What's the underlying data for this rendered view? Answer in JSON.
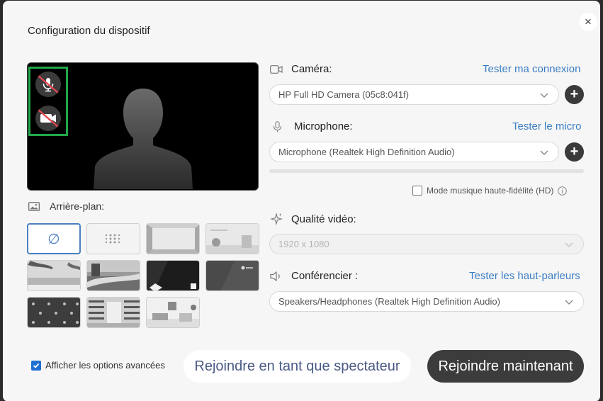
{
  "dialog": {
    "title": "Configuration du dispositif",
    "close": "×"
  },
  "camera": {
    "label": "Caméra:",
    "link": "Tester ma connexion",
    "selected": "HP Full HD Camera (05c8:041f)"
  },
  "microphone": {
    "label": "Microphone:",
    "link": "Tester le micro",
    "selected": "Microphone (Realtek High Definition Audio)"
  },
  "hifi": {
    "label": "Mode musique haute-fidélité (HD)",
    "checked": false
  },
  "video_quality": {
    "label": "Qualité vidéo:",
    "selected": "1920 x 1080",
    "disabled": true
  },
  "speaker": {
    "label": "Conférencier :",
    "link": "Tester les haut-parleurs",
    "selected": "Speakers/Headphones (Realtek High Definition Audio)"
  },
  "background": {
    "label": "Arrière-plan:",
    "none_symbol": "∅",
    "thumbnails": [
      "none",
      "blur",
      "empty-room",
      "white-room",
      "beach",
      "coast",
      "dark-brand",
      "gray-brand",
      "branded-pattern",
      "library",
      "office"
    ]
  },
  "footer": {
    "advanced_label": "Afficher les options avancées",
    "advanced_checked": true,
    "spectator_button": "Rejoindre en tant que spectateur",
    "join_button": "Rejoindre maintenant"
  },
  "colors": {
    "accent": "#3b7dc4",
    "highlight": "#22a64a",
    "dark_button": "#3c3c3c"
  }
}
